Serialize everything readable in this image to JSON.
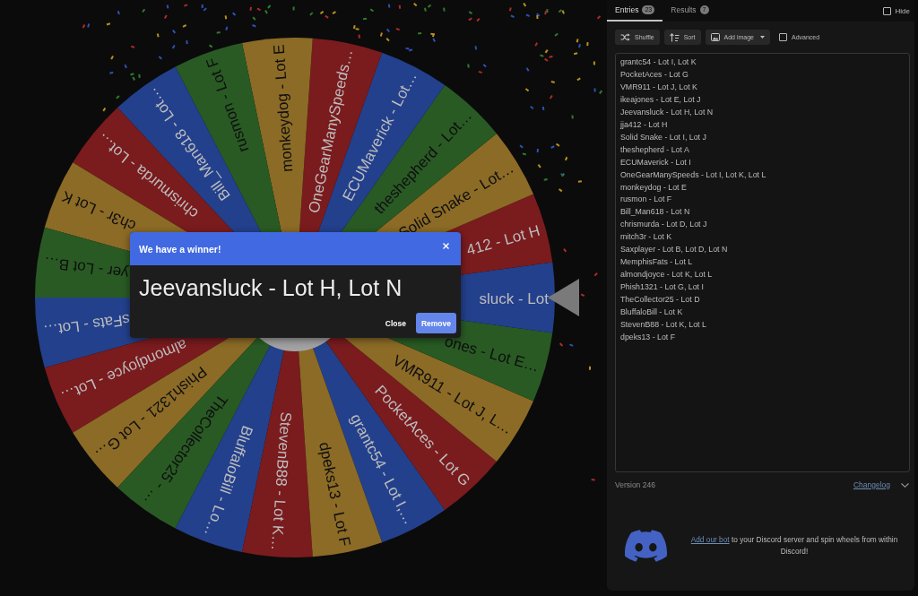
{
  "wheel": {
    "segments": [
      {
        "label": "grantc54 - Lot I,…",
        "color": "#23408c"
      },
      {
        "label": "PocketAces - Lot G",
        "color": "#7a1b1e"
      },
      {
        "label": "VMR911 - Lot J, L…",
        "color": "#8c6b26"
      },
      {
        "label": "ones - Lot E…",
        "color": "#295a24"
      },
      {
        "label": "sluck - Lot",
        "color": "#23408c"
      },
      {
        "label": "412 - Lot H",
        "color": "#7a1b1e"
      },
      {
        "label": "Solid Snake - Lot…",
        "color": "#8c6b26"
      },
      {
        "label": "theshepherd - Lot…",
        "color": "#295a24"
      },
      {
        "label": "ECUMaverick - Lot…",
        "color": "#23408c"
      },
      {
        "label": "OneGearManySpeeds…",
        "color": "#7a1b1e"
      },
      {
        "label": "monkeydog - Lot E",
        "color": "#8c6b26"
      },
      {
        "label": "rusmon - Lot F",
        "color": "#295a24"
      },
      {
        "label": "Bill_Man618 - Lot…",
        "color": "#23408c"
      },
      {
        "label": "chrismurda - Lot…",
        "color": "#7a1b1e"
      },
      {
        "label": "ch3r - Lot K",
        "color": "#8c6b26"
      },
      {
        "label": "yer - Lot B…",
        "color": "#295a24"
      },
      {
        "label": "sFats - Lot…",
        "color": "#23408c"
      },
      {
        "label": "almondjoyce - Lot…",
        "color": "#7a1b1e"
      },
      {
        "label": "Phish1321 - Lot G…",
        "color": "#8c6b26"
      },
      {
        "label": "TheCollector25 - …",
        "color": "#295a24"
      },
      {
        "label": "BluffaloBill - Lo…",
        "color": "#23408c"
      },
      {
        "label": "StevenB88 - Lot K…",
        "color": "#7a1b1e"
      },
      {
        "label": "dpeks13 - Lot F",
        "color": "#8c6b26"
      }
    ]
  },
  "winner_dialog": {
    "title": "We have a winner!",
    "winner": "Jeevansluck - Lot H, Lot N",
    "buttons": [
      {
        "label": "Close",
        "kind": "text"
      },
      {
        "label": "Remove",
        "kind": "filled"
      }
    ]
  },
  "tabs": [
    {
      "label": "Entries",
      "count": "23",
      "selected": true
    },
    {
      "label": "Results",
      "count": "7",
      "selected": false
    }
  ],
  "hide": {
    "label": "Hide",
    "checked": false
  },
  "toolbar": {
    "buttons": [
      {
        "label": "Shuffle",
        "dropdown": false
      },
      {
        "label": "Sort",
        "dropdown": false
      },
      {
        "label": "Add image",
        "dropdown": true
      }
    ],
    "advanced": {
      "label": "Advanced",
      "checked": false
    }
  },
  "entries": [
    "grantc54 - Lot I, Lot K",
    "PocketAces - Lot G",
    "VMR911 - Lot J, Lot K",
    "ikeajones - Lot E, Lot J",
    "Jeevansluck - Lot H, Lot N",
    "jja412 - Lot H",
    "Solid Snake - Lot I, Lot J",
    "theshepherd - Lot A",
    "ECUMaverick - Lot I",
    "OneGearManySpeeds - Lot I, Lot K, Lot L",
    "monkeydog - Lot E",
    "rusmon - Lot F",
    "Bill_Man618 - Lot N",
    "chrismurda - Lot D, Lot J",
    "mitch3r - Lot K",
    "Saxplayer - Lot B, Lot D, Lot N",
    "MemphisFats - Lot L",
    "almondjoyce - Lot K, Lot L",
    "Phish1321 - Lot G, Lot I",
    "TheCollector25 - Lot D",
    "BluffaloBill - Lot K",
    "StevenB88 - Lot K, Lot L",
    "dpeks13 - Lot F"
  ],
  "footer": {
    "version": "Version 246",
    "changelog": "Changelog"
  },
  "discord": {
    "link": "Add our bot",
    "text": "to your Discord server and spin wheels from within Discord!"
  }
}
